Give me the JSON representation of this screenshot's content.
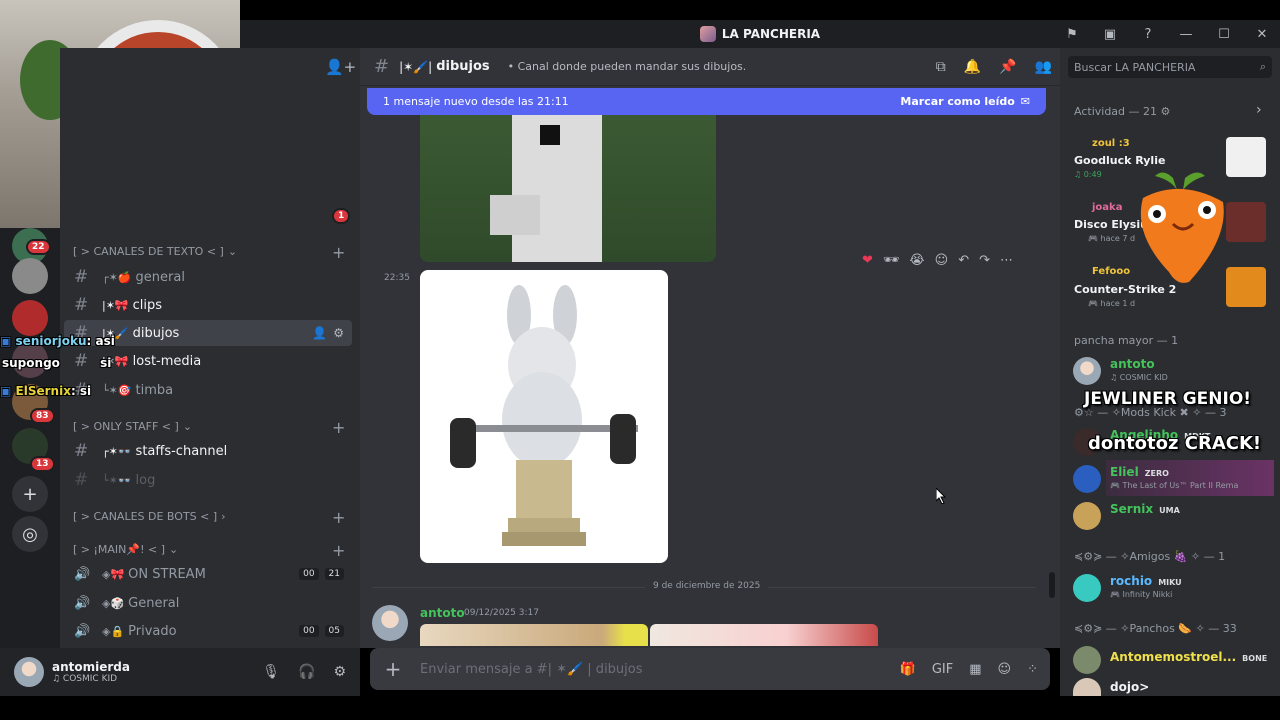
{
  "window": {
    "title": "LA PANCHERIA"
  },
  "channel_sidebar": {
    "categories": [
      {
        "label": "[ > CANALES DE TEXTO < ]"
      },
      {
        "label": "[ > ONLY STAFF < ]"
      },
      {
        "label": "[ > CANALES DE BOTS < ]"
      },
      {
        "label": "[ > ¡MAIN📌! < ]"
      }
    ],
    "channels": [
      {
        "prefix": "┌✶🍎",
        "name": "general"
      },
      {
        "prefix": "|✶🎀",
        "name": "clips"
      },
      {
        "prefix": "|✶🖌️",
        "name": "dibujos"
      },
      {
        "prefix": "|✶🎀",
        "name": "lost-media"
      },
      {
        "prefix": "└✶🎯",
        "name": "timba"
      },
      {
        "prefix": "┌✶👓",
        "name": "staffs-channel"
      },
      {
        "prefix": "└✶👓",
        "name": "log"
      }
    ],
    "voice_channels": [
      {
        "prefix": "◈🎀",
        "name": "ON STREAM",
        "count_a": "00",
        "count_b": "21"
      },
      {
        "prefix": "◈🎲",
        "name": "General"
      },
      {
        "prefix": "◈🔒",
        "name": "Privado",
        "count_a": "00",
        "count_b": "05"
      }
    ],
    "server_badges": [
      "22",
      "83",
      "13"
    ],
    "server_top_badge": "1"
  },
  "user_panel": {
    "username": "antomierda",
    "status": "♫ COSMIC KID"
  },
  "chat": {
    "channel_name": "dibujos",
    "channel_prefix": "|✶🖌️|",
    "topic": "• Canal donde pueden mandar sus dibujos.",
    "new_messages": "1 mensaje nuevo desde las 21:11",
    "mark_read": "Marcar como leído",
    "time_2235": "22:35",
    "date_divider": "9 de diciembre de 2025",
    "last_author": "antoto",
    "last_time": "09/12/2025 3:17",
    "composer_placeholder": "Enviar mensaje a #| ✶🖌️ | dibujos"
  },
  "members": {
    "search_placeholder": "Buscar LA PANCHERIA",
    "activity_header": "Actividad — 21 ⚙",
    "activities": [
      {
        "user": "zoul :3",
        "game": "Goodluck Rylie",
        "sub": "♫ 0:49",
        "user_color": "#f0c43a"
      },
      {
        "user": "joaka",
        "game": "Disco Elysium",
        "sub": "🎮 hace 7 d",
        "user_color": "#e26b9c"
      },
      {
        "user": "Fefooo",
        "game": "Counter-Strike 2",
        "sub": "🎮 hace 1 d",
        "user_color": "#f0c43a"
      }
    ],
    "groups": [
      {
        "header": "pancha mayor — 1"
      },
      {
        "header": "⚙☆ — ✧Mods Kick ✖ ✧ — 3"
      },
      {
        "header": "≼⚙≽ — ✧Amigos 🍇 ✧ — 1"
      },
      {
        "header": "≼⚙≽ — ✧Panchos 🌭 ✧ — 33"
      }
    ],
    "people": [
      {
        "name": "antoto",
        "sub": "♫ COSMIC KID",
        "color": "#43c35a",
        "tag": ""
      },
      {
        "name": "Angelinho",
        "sub": "",
        "color": "#43c35a",
        "tag": "MDKT"
      },
      {
        "name": "Eliel",
        "sub": "🎮 The Last of Us™ Part II Rema",
        "color": "#43c35a",
        "tag": "ZERO"
      },
      {
        "name": "Sernix",
        "sub": "",
        "color": "#43c35a",
        "tag": "UMA"
      },
      {
        "name": "rochio",
        "sub": "🎮 Infinity Nikki",
        "color": "#5ab9ff",
        "tag": "MIKU"
      },
      {
        "name": "Antomemostroel...",
        "sub": "",
        "color": "#f0e04a",
        "tag": "BONE"
      },
      {
        "name": "dojo>",
        "sub": "",
        "color": "#f2f3f5",
        "tag": ""
      }
    ]
  },
  "overlays": {
    "chat_lines": [
      {
        "user": "seniorjoku",
        "text": ": asi"
      },
      {
        "user": "supongo",
        "text": "si"
      },
      {
        "user": "ElSernix",
        "text": ": si"
      }
    ],
    "big_text_1": "JEWLINER GENIO!",
    "big_text_2": "dontotoz CRACK!"
  },
  "colors": {
    "accent": "#5865f2",
    "online": "#23a55a",
    "dnd": "#da373c"
  }
}
